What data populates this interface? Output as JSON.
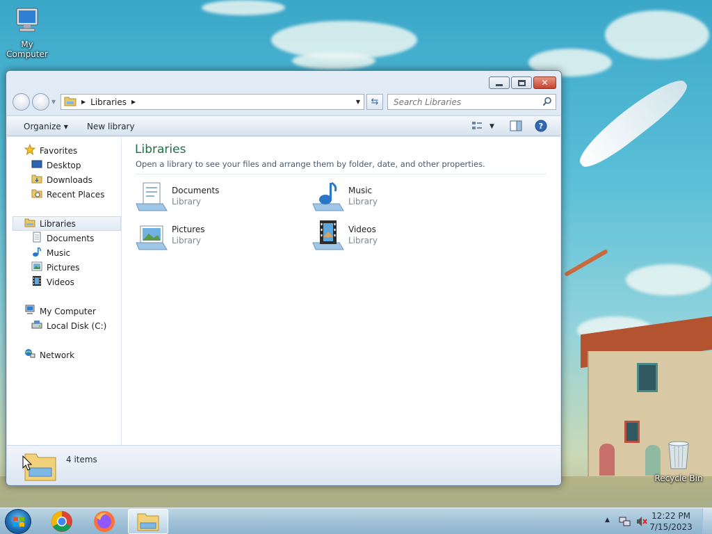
{
  "desktop": {
    "icons": [
      {
        "label": "My Computer",
        "icon": "computer-icon"
      },
      {
        "label": "Recycle Bin",
        "icon": "recycle-bin-icon"
      }
    ]
  },
  "window": {
    "address": {
      "crumbs": [
        "Libraries"
      ]
    },
    "search": {
      "placeholder": "Search Libraries"
    },
    "toolbar": {
      "organize": "Organize",
      "new_library": "New library"
    },
    "nav_pane": {
      "favorites": "Favorites",
      "desktop": "Desktop",
      "downloads": "Downloads",
      "recent_places": "Recent Places",
      "libraries": "Libraries",
      "documents": "Documents",
      "music": "Music",
      "pictures": "Pictures",
      "videos": "Videos",
      "my_computer": "My Computer",
      "local_disk": "Local Disk (C:)",
      "network": "Network"
    },
    "main": {
      "title": "Libraries",
      "subtitle": "Open a library to see your files and arrange them by folder, date, and other properties.",
      "libraries": [
        {
          "name": "Documents",
          "kind": "Library",
          "icon": "documents-library-icon"
        },
        {
          "name": "Music",
          "kind": "Library",
          "icon": "music-library-icon"
        },
        {
          "name": "Pictures",
          "kind": "Library",
          "icon": "pictures-library-icon"
        },
        {
          "name": "Videos",
          "kind": "Library",
          "icon": "videos-library-icon"
        }
      ]
    },
    "details": {
      "count": "4 items"
    }
  },
  "taskbar": {
    "apps": [
      "Google Chrome",
      "Firefox",
      "Windows Explorer"
    ],
    "clock": {
      "time": "12:22 PM",
      "date": "7/15/2023"
    }
  },
  "colors": {
    "accent_green": "#1d6f46",
    "window_frame": "#cddceb",
    "close_red": "#c5452d"
  }
}
